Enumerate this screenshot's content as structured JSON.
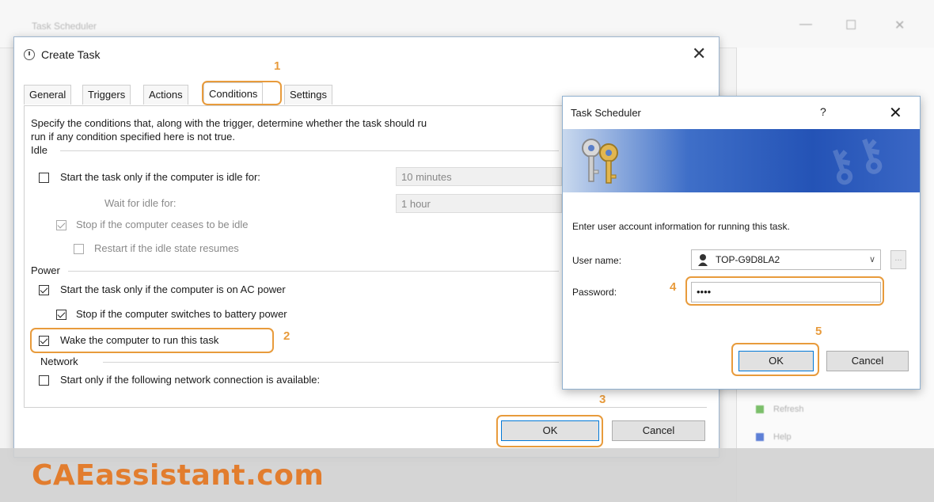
{
  "background_window": {
    "title": "Task Scheduler",
    "right_pane_items": [
      "Refresh",
      "Help"
    ]
  },
  "create_task": {
    "title": "Create Task",
    "tabs": [
      "General",
      "Triggers",
      "Actions",
      "Conditions",
      "Settings"
    ],
    "active_tab": "Conditions",
    "description_line1": "Specify the conditions that, along with the trigger, determine whether the task should ru",
    "description_line2": "run  if any condition specified here is not true.",
    "idle": {
      "group": "Idle",
      "start_if_idle_label": "Start the task only if the computer is idle for:",
      "idle_for_value": "10 minutes",
      "wait_label": "Wait for idle for:",
      "wait_value": "1 hour",
      "stop_if_ceases_label": "Stop if the computer ceases to be idle",
      "restart_label": "Restart if the idle state resumes"
    },
    "power": {
      "group": "Power",
      "ac_power_label": "Start the task only if the computer is on AC power",
      "battery_label": "Stop if the computer switches to battery power",
      "wake_label": "Wake the computer to run this task"
    },
    "network": {
      "group": "Network",
      "connection_label": "Start only if the following network connection is available:"
    },
    "ok_label": "OK",
    "cancel_label": "Cancel"
  },
  "credentials_dialog": {
    "title": "Task Scheduler",
    "help": "?",
    "close": "✕",
    "prompt": "Enter user account information for running this task.",
    "user_name_label": "User name:",
    "user_name_value": "TOP-G9D8LA2",
    "password_label": "Password:",
    "password_value": "••••",
    "ok_label": "OK",
    "cancel_label": "Cancel"
  },
  "steps": [
    "1",
    "2",
    "3",
    "4",
    "5"
  ],
  "brand": "CAEassistant.com",
  "colors": {
    "highlight": "#e89b3c",
    "brand": "#e27d2e",
    "banner_blue": "#2453b6"
  }
}
